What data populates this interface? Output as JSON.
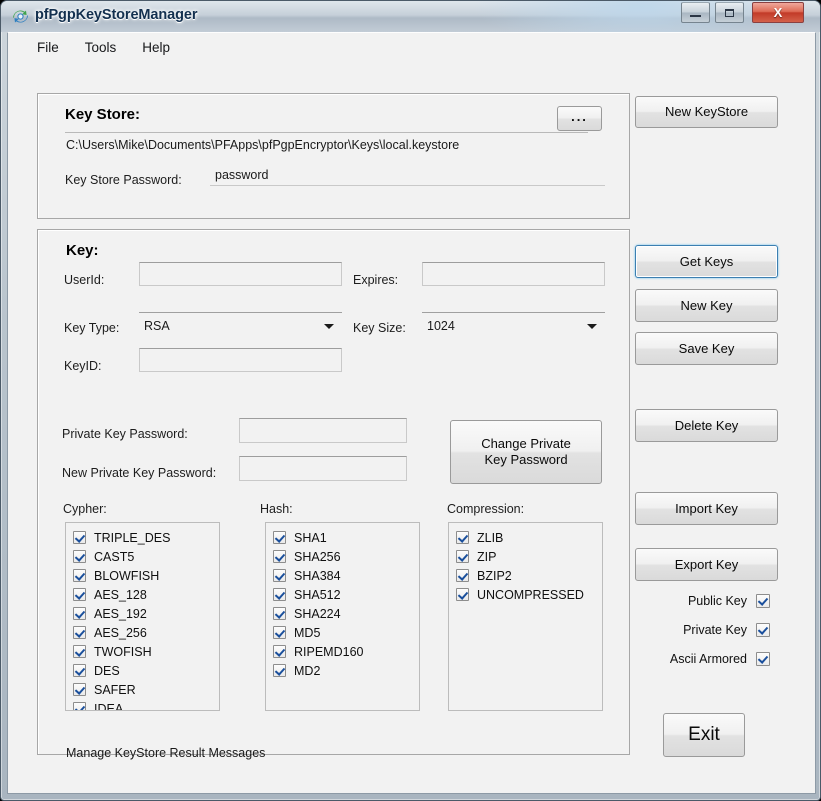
{
  "window": {
    "title": "pfPgpKeyStoreManager",
    "icon": "app-icon",
    "controls": {
      "minimize": "minimize-icon",
      "maximize": "maximize-icon",
      "close": "X"
    }
  },
  "menubar": {
    "items": [
      {
        "label": "File"
      },
      {
        "label": "Tools"
      },
      {
        "label": "Help"
      }
    ]
  },
  "keystore_group": {
    "title": "Key Store:",
    "browse_button": "...",
    "path": "C:\\Users\\Mike\\Documents\\PFApps\\pfPgpEncryptor\\Keys\\local.keystore",
    "password_label": "Key Store Password:",
    "password_value": "password"
  },
  "key_group": {
    "title": "Key:",
    "userid_label": "UserId:",
    "userid_value": "",
    "expires_label": "Expires:",
    "expires_value": "",
    "keytype_label": "Key Type:",
    "keytype_value": "RSA",
    "keysize_label": "Key Size:",
    "keysize_value": "1024",
    "keyid_label": "KeyID:",
    "keyid_value": "",
    "private_key_password_label": "Private Key Password:",
    "private_key_password_value": "",
    "new_private_key_password_label": "New Private Key Password:",
    "new_private_key_password_value": "",
    "change_password_button": "Change Private\nKey Password",
    "status_text": "Manage KeyStore Result Messages"
  },
  "cypher": {
    "label": "Cypher:",
    "items": [
      {
        "label": "TRIPLE_DES",
        "checked": true
      },
      {
        "label": "CAST5",
        "checked": true
      },
      {
        "label": "BLOWFISH",
        "checked": true
      },
      {
        "label": "AES_128",
        "checked": true
      },
      {
        "label": "AES_192",
        "checked": true
      },
      {
        "label": "AES_256",
        "checked": true
      },
      {
        "label": "TWOFISH",
        "checked": true
      },
      {
        "label": "DES",
        "checked": true
      },
      {
        "label": "SAFER",
        "checked": true
      },
      {
        "label": "IDEA",
        "checked": true
      }
    ]
  },
  "hash": {
    "label": "Hash:",
    "items": [
      {
        "label": "SHA1",
        "checked": true
      },
      {
        "label": "SHA256",
        "checked": true
      },
      {
        "label": "SHA384",
        "checked": true
      },
      {
        "label": "SHA512",
        "checked": true
      },
      {
        "label": "SHA224",
        "checked": true
      },
      {
        "label": "MD5",
        "checked": true
      },
      {
        "label": "RIPEMD160",
        "checked": true
      },
      {
        "label": "MD2",
        "checked": true
      }
    ]
  },
  "compression": {
    "label": "Compression:",
    "items": [
      {
        "label": "ZLIB",
        "checked": true
      },
      {
        "label": "ZIP",
        "checked": true
      },
      {
        "label": "BZIP2",
        "checked": true
      },
      {
        "label": "UNCOMPRESSED",
        "checked": true
      }
    ]
  },
  "side_buttons": {
    "new_keystore": "New KeyStore",
    "get_keys": "Get Keys",
    "new_key": "New Key",
    "save_key": "Save Key",
    "delete_key": "Delete Key",
    "import_key": "Import Key",
    "export_key": "Export Key",
    "exit": "Exit"
  },
  "export_options": [
    {
      "label": "Public Key",
      "checked": true
    },
    {
      "label": "Private Key",
      "checked": true
    },
    {
      "label": "Ascii Armored",
      "checked": true
    }
  ],
  "colors": {
    "focus_border": "#3c7fb1",
    "close_button": "#c23a28",
    "check_mark": "#1a4f9c",
    "client_background": "#f2f2f2"
  }
}
